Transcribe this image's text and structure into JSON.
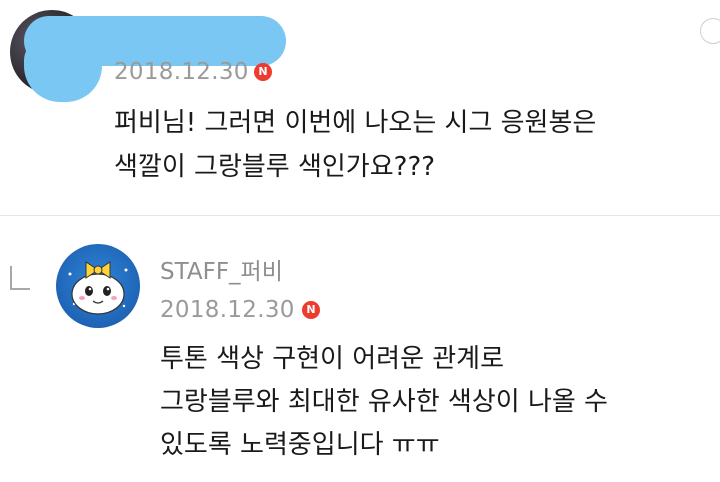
{
  "comment": {
    "date": "2018.12.30",
    "new_badge": "N",
    "lines": [
      "퍼비님! 그러면 이번에 나오는 시그 응원봉은",
      "색깔이 그랑블루 색인가요???"
    ]
  },
  "reply": {
    "username": "STAFF_퍼비",
    "date": "2018.12.30",
    "new_badge": "N",
    "lines": [
      "투톤 색상 구현이 어려운 관계로",
      "그랑블루와 최대한 유사한 색상이 나올 수",
      "있도록 노력중입니다 ㅠㅠ"
    ]
  },
  "colors": {
    "redaction": "#79c7f2",
    "new_badge": "#ec3b2f",
    "staff_avatar": "#1f64b6"
  }
}
